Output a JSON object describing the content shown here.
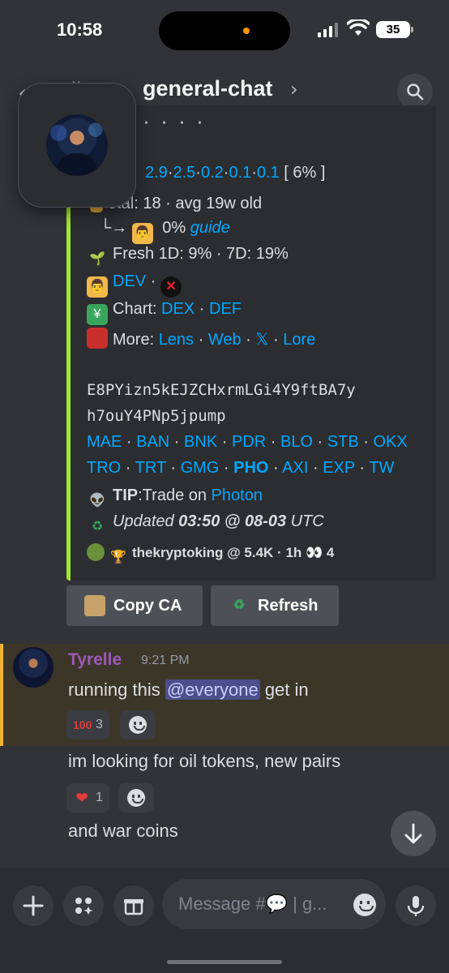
{
  "status": {
    "time": "10:58",
    "battery": "35"
  },
  "header": {
    "channel": "general-chat",
    "hash_glyph": "#",
    "chevron": "›"
  },
  "embed": {
    "accent": "#a3e635",
    "top_cut": "· · · ·",
    "holders_vals": [
      {
        "text": "2.9",
        "link": true
      },
      {
        "text": "·",
        "link": false
      },
      {
        "text": "2.5",
        "link": true
      },
      {
        "text": "·",
        "link": false
      },
      {
        "text": "0.2",
        "link": true
      },
      {
        "text": "·",
        "link": false
      },
      {
        "text": "0.1",
        "link": true
      },
      {
        "text": "·",
        "link": false
      },
      {
        "text": "0.1",
        "link": true
      }
    ],
    "holders_pct": " [ 6% ]",
    "total_line": "otal: 18  ·  avg 19w old",
    "guide_prefix": "└→",
    "guide_pct": " 0% ",
    "guide_link": "guide",
    "fresh": "Fresh 1D: 9%  ·  7D: 19%",
    "dev_link": "DEV",
    "dev_sep": " · ",
    "chart_label": "Chart: ",
    "chart_links": [
      "DEX",
      "DEF"
    ],
    "more_label": "More: ",
    "more_links": [
      "Lens",
      "Web",
      "𝕏",
      "Lore"
    ],
    "ca_line1": "E8PYizn5kEJZCHxrmLGi4Y9ftBA7y",
    "ca_line2": "h7ouY4PNp5jpump",
    "bots_row1": [
      "MAE",
      "BAN",
      "BNK",
      "PDR",
      "BLO",
      "STB",
      "OKX"
    ],
    "bots_row2": [
      "TRO",
      "TRT",
      "GMG",
      "PHO",
      "AXI",
      "EXP",
      "TW"
    ],
    "tip_label": "TIP",
    "tip_text": ":Trade on ",
    "tip_link": "Photon",
    "updated_label": "Updated ",
    "updated_time": "03:50 @ 08-03",
    "updated_tz": " UTC",
    "footer": "thekryptoking @ 5.4K  ·  1h",
    "footer_count": "4"
  },
  "buttons": {
    "copy": "Copy CA",
    "refresh": "Refresh"
  },
  "message": {
    "author": "Tyrelle",
    "author_color": "#9b59b6",
    "timestamp": "9:21 PM",
    "text1_pre": "running this ",
    "mention": "@everyone",
    "text1_post": " get in",
    "reaction1_count": "3",
    "text2": "im looking for oil tokens, new pairs",
    "reaction2_count": "1",
    "text3": "and war coins"
  },
  "composer": {
    "placeholder": "Message #💬 | g..."
  }
}
